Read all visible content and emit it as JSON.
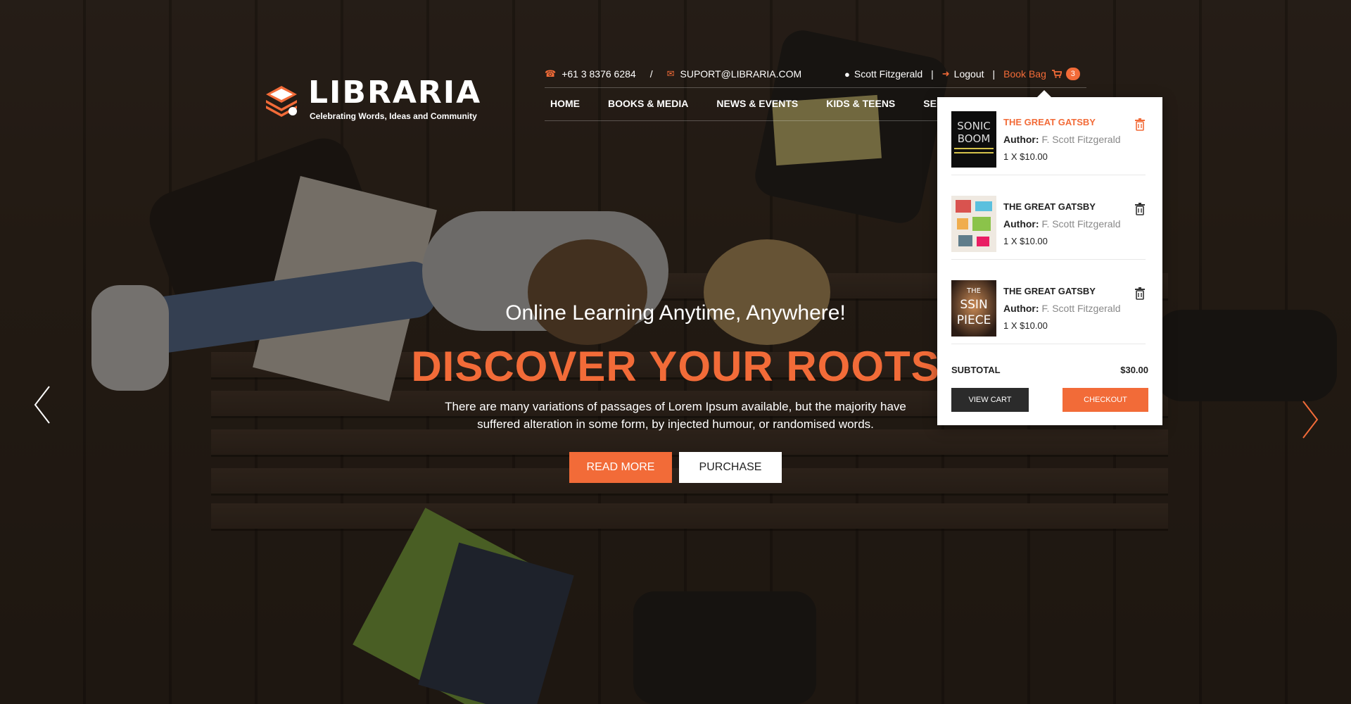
{
  "brand": {
    "name": "LIBRARIA",
    "tagline": "Celebrating Words, Ideas and Community"
  },
  "contact": {
    "phone": "+61 3 8376 6284",
    "separator": "/",
    "email": "SUPORT@LIBRARIA.COM",
    "phone_icon": "phone-icon",
    "email_icon": "envelope-icon"
  },
  "user": {
    "name": "Scott Fitzgerald",
    "logout": "Logout",
    "bag_label": "Book Bag",
    "bag_count": "3",
    "separator": "|",
    "user_icon": "user-icon",
    "logout_icon": "sign-out-icon",
    "cart_icon": "shopping-cart-icon"
  },
  "nav": {
    "items": [
      {
        "label": "HOME"
      },
      {
        "label": "BOOKS & MEDIA"
      },
      {
        "label": "NEWS & EVENTS"
      },
      {
        "label": "KIDS & TEENS"
      },
      {
        "label": "SERVICES"
      }
    ]
  },
  "hero": {
    "kicker": "Online Learning Anytime, Anywhere!",
    "headline": "DISCOVER YOUR ROOTS",
    "description": "There are many variations of passages of Lorem Ipsum available, but the majority have suffered alteration in some form, by injected humour, or randomised words.",
    "read_more": "READ MORE",
    "purchase": "PURCHASE"
  },
  "cart": {
    "items": [
      {
        "title": "THE GREAT GATSBY",
        "author_label": "Author:",
        "author": "F. Scott Fitzgerald",
        "price": "1 X $10.00",
        "cover_text": "SONIC BOOM",
        "highlight": true
      },
      {
        "title": "THE GREAT GATSBY",
        "author_label": "Author:",
        "author": "F. Scott Fitzgerald",
        "price": "1 X $10.00",
        "cover_text": "",
        "highlight": false
      },
      {
        "title": "THE GREAT GATSBY",
        "author_label": "Author:",
        "author": "F. Scott Fitzgerald",
        "price": "1 X $10.00",
        "cover_text": "THE MISSING PIECE",
        "highlight": false
      }
    ],
    "subtotal_label": "SUBTOTAL",
    "subtotal_value": "$30.00",
    "view_cart": "VIEW CART",
    "checkout": "CHECKOUT",
    "trash_icon": "trash-icon"
  },
  "colors": {
    "accent": "#f26b38",
    "dark": "#2b2b2b"
  }
}
